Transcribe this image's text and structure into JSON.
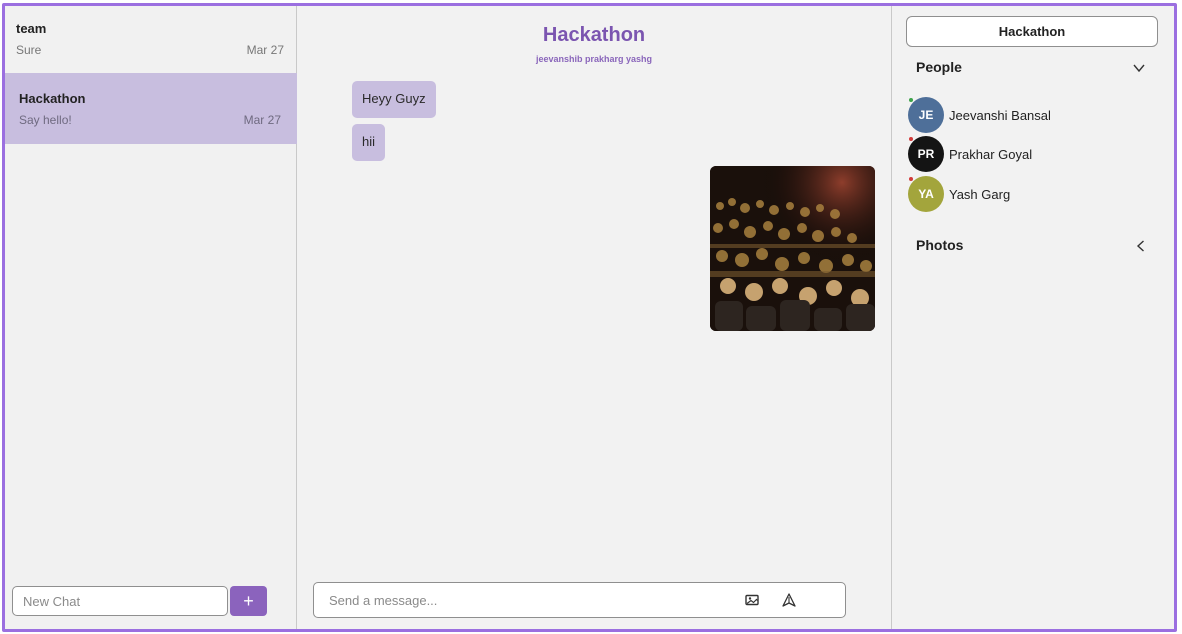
{
  "sidebar": {
    "chats": [
      {
        "name": "team",
        "preview": "Sure",
        "date": "Mar 27"
      },
      {
        "name": "Hackathon",
        "preview": "Say hello!",
        "date": "Mar 27"
      }
    ],
    "new_chat_placeholder": "New Chat",
    "add_button_label": "+"
  },
  "chat": {
    "title": "Hackathon",
    "members": "jeevanshib prakharg yashg",
    "messages": [
      "Heyy Guyz",
      "hii"
    ],
    "composer_placeholder": "Send a message..."
  },
  "right_panel": {
    "group_name": "Hackathon",
    "people_label": "People",
    "photos_label": "Photos",
    "people": [
      {
        "initials": "JE",
        "name": "Jeevanshi Bansal",
        "color": "#4e6f99",
        "status_color": "#3ea34a"
      },
      {
        "initials": "PR",
        "name": "Prakhar Goyal",
        "color": "#141414",
        "status_color": "#d23b3b"
      },
      {
        "initials": "YA",
        "name": "Yash Garg",
        "color": "#a3a53c",
        "status_color": "#d23b3b"
      }
    ]
  },
  "colors": {
    "accent": "#8b63bd",
    "selected_chat": "#c8bedf",
    "border": "#9b6fe0"
  }
}
